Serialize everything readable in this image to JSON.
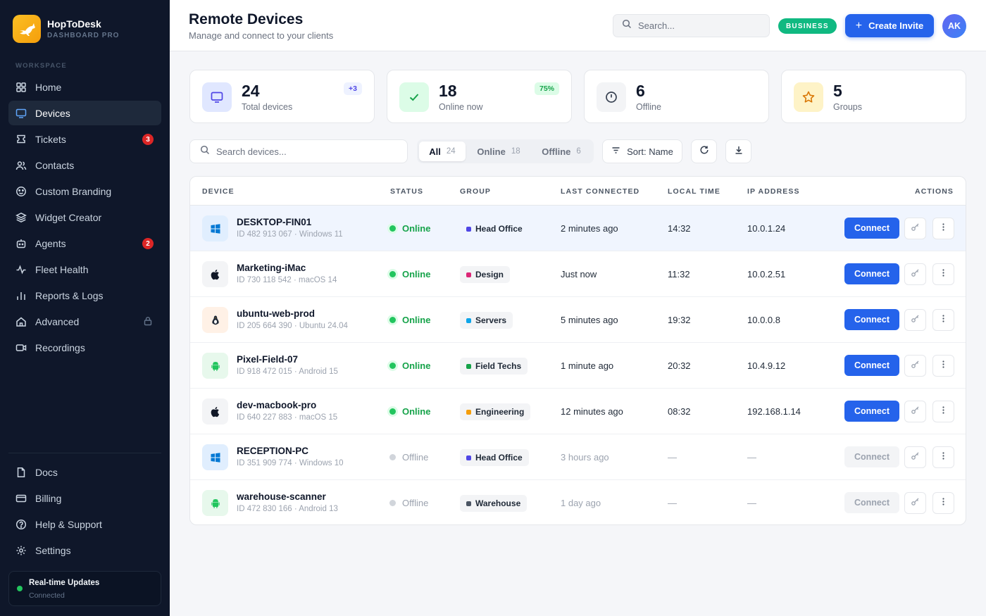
{
  "brand": {
    "name": "HopToDesk",
    "subtitle": "DASHBOARD PRO"
  },
  "sidebar": {
    "section_label": "WORKSPACE",
    "items": [
      {
        "label": "Home",
        "icon": "grid-icon"
      },
      {
        "label": "Devices",
        "icon": "monitor-icon",
        "active": true
      },
      {
        "label": "Tickets",
        "icon": "ticket-icon",
        "badge": "3"
      },
      {
        "label": "Contacts",
        "icon": "users-icon"
      },
      {
        "label": "Custom Branding",
        "icon": "palette-icon"
      },
      {
        "label": "Widget Creator",
        "icon": "layers-icon"
      },
      {
        "label": "Agents",
        "icon": "bot-icon",
        "badge": "2"
      },
      {
        "label": "Fleet Health",
        "icon": "activity-icon"
      },
      {
        "label": "Reports & Logs",
        "icon": "bar-chart-icon"
      },
      {
        "label": "Advanced",
        "icon": "home-icon",
        "locked": true
      },
      {
        "label": "Recordings",
        "icon": "video-icon"
      }
    ],
    "bottom_items": [
      {
        "label": "Docs",
        "icon": "document-icon"
      },
      {
        "label": "Billing",
        "icon": "credit-card-icon"
      },
      {
        "label": "Help & Support",
        "icon": "help-icon"
      },
      {
        "label": "Settings",
        "icon": "gear-icon"
      }
    ],
    "realtime": {
      "title": "Real-time Updates",
      "status": "Connected"
    }
  },
  "header": {
    "title": "Remote Devices",
    "subtitle": "Manage and connect to your clients",
    "search_placeholder": "Search...",
    "plan_badge": "BUSINESS",
    "create_label": "Create Invite",
    "avatar_initials": "AK"
  },
  "stats": [
    {
      "value": "24",
      "label": "Total devices",
      "chip": "+3",
      "icon": "monitor-icon"
    },
    {
      "value": "18",
      "label": "Online now",
      "chip": "75%",
      "icon": "check-icon"
    },
    {
      "value": "6",
      "label": "Offline",
      "chip": "",
      "icon": "clock-icon"
    },
    {
      "value": "5",
      "label": "Groups",
      "chip": "",
      "icon": "star-icon"
    }
  ],
  "toolbar": {
    "search_placeholder": "Search devices...",
    "filters": [
      {
        "label": "All",
        "count": "24",
        "active": true
      },
      {
        "label": "Online",
        "count": "18"
      },
      {
        "label": "Offline",
        "count": "6"
      }
    ],
    "sort_label": "Sort: Name"
  },
  "table": {
    "columns": [
      "DEVICE",
      "STATUS",
      "GROUP",
      "LAST CONNECTED",
      "LOCAL TIME",
      "IP ADDRESS",
      "ACTIONS"
    ],
    "connect_label": "Connect",
    "rows": [
      {
        "name": "DESKTOP-FIN01",
        "meta": "ID 482 913 067 · Windows 11",
        "os": "windows",
        "status": "Online",
        "group": "Head Office",
        "group_color": "#4f46e5",
        "last": "2 minutes ago",
        "time": "14:32",
        "ip": "10.0.1.24"
      },
      {
        "name": "Marketing-iMac",
        "meta": "ID 730 118 542 · macOS 14",
        "os": "apple",
        "status": "Online",
        "group": "Design",
        "group_color": "#db2777",
        "last": "Just now",
        "time": "11:32",
        "ip": "10.0.2.51"
      },
      {
        "name": "ubuntu-web-prod",
        "meta": "ID 205 664 390 · Ubuntu 24.04",
        "os": "linux",
        "status": "Online",
        "group": "Servers",
        "group_color": "#0ea5e9",
        "last": "5 minutes ago",
        "time": "19:32",
        "ip": "10.0.0.8"
      },
      {
        "name": "Pixel-Field-07",
        "meta": "ID 918 472 015 · Android 15",
        "os": "android",
        "status": "Online",
        "group": "Field Techs",
        "group_color": "#16a34a",
        "last": "1 minute ago",
        "time": "20:32",
        "ip": "10.4.9.12"
      },
      {
        "name": "dev-macbook-pro",
        "meta": "ID 640 227 883 · macOS 15",
        "os": "apple",
        "status": "Online",
        "group": "Engineering",
        "group_color": "#f59e0b",
        "last": "12 minutes ago",
        "time": "08:32",
        "ip": "192.168.1.14"
      },
      {
        "name": "RECEPTION-PC",
        "meta": "ID 351 909 774 · Windows 10",
        "os": "windows",
        "status": "Offline",
        "group": "Head Office",
        "group_color": "#4f46e5",
        "last": "3 hours ago",
        "time": "—",
        "ip": "—"
      },
      {
        "name": "warehouse-scanner",
        "meta": "ID 472 830 166 · Android 13",
        "os": "android",
        "status": "Offline",
        "group": "Warehouse",
        "group_color": "#4b5563",
        "last": "1 day ago",
        "time": "—",
        "ip": "—"
      }
    ]
  }
}
